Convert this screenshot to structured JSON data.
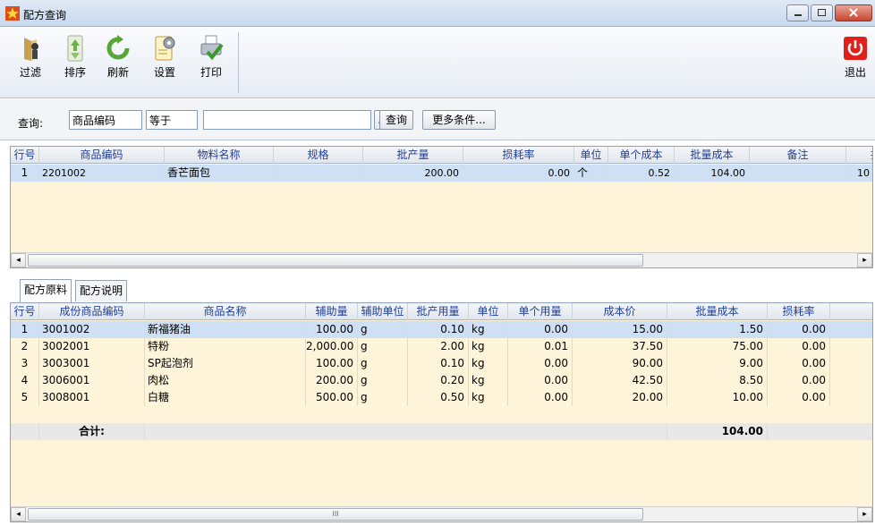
{
  "window": {
    "title": "配方查询"
  },
  "toolbar": {
    "filter": "过滤",
    "sort": "排序",
    "refresh": "刷新",
    "settings": "设置",
    "print": "打印",
    "exit": "退出"
  },
  "query": {
    "label": "查询:",
    "field": "商品编码",
    "operator": "等于",
    "value": "",
    "browse": "...",
    "search": "查询",
    "more": "更多条件..."
  },
  "main_grid": {
    "headers": [
      "行号",
      "商品编码",
      "物料名称",
      "规格",
      "批产量",
      "损耗率",
      "单位",
      "单个成本",
      "批量成本",
      "备注",
      "批"
    ],
    "rows": [
      {
        "no": "1",
        "code": "2201002",
        "name": "香芒面包",
        "spec": "",
        "batch": "200.00",
        "loss": "0.00",
        "unit": "个",
        "unit_cost": "0.52",
        "batch_cost": "104.00",
        "note": "",
        "extra": "10"
      }
    ]
  },
  "tabs": {
    "ingredients": "配方原料",
    "description": "配方说明"
  },
  "detail_grid": {
    "headers": [
      "行号",
      "成份商品编码",
      "商品名称",
      "辅助量",
      "辅助单位",
      "批产用量",
      "单位",
      "单个用量",
      "成本价",
      "批量成本",
      "损耗率"
    ],
    "rows": [
      {
        "no": "1",
        "code": "3001002",
        "name": "新福猪油",
        "aux": "100.00",
        "aux_unit": "g",
        "batch_qty": "0.10",
        "unit": "kg",
        "single": "0.00",
        "price": "15.00",
        "batch_cost": "1.50",
        "loss": "0.00"
      },
      {
        "no": "2",
        "code": "3002001",
        "name": "特粉",
        "aux": "2,000.00",
        "aux_unit": "g",
        "batch_qty": "2.00",
        "unit": "kg",
        "single": "0.01",
        "price": "37.50",
        "batch_cost": "75.00",
        "loss": "0.00"
      },
      {
        "no": "3",
        "code": "3003001",
        "name": "SP起泡剂",
        "aux": "100.00",
        "aux_unit": "g",
        "batch_qty": "0.10",
        "unit": "kg",
        "single": "0.00",
        "price": "90.00",
        "batch_cost": "9.00",
        "loss": "0.00"
      },
      {
        "no": "4",
        "code": "3006001",
        "name": "肉松",
        "aux": "200.00",
        "aux_unit": "g",
        "batch_qty": "0.20",
        "unit": "kg",
        "single": "0.00",
        "price": "42.50",
        "batch_cost": "8.50",
        "loss": "0.00"
      },
      {
        "no": "5",
        "code": "3008001",
        "name": "白糖",
        "aux": "500.00",
        "aux_unit": "g",
        "batch_qty": "0.50",
        "unit": "kg",
        "single": "0.00",
        "price": "20.00",
        "batch_cost": "10.00",
        "loss": "0.00"
      }
    ],
    "total_label": "合计:",
    "total_batch_cost": "104.00"
  },
  "scroll": {
    "left": "◂",
    "right": "▸",
    "grip": "III"
  },
  "colors": {
    "grid_bg": "#fdf4d9",
    "selected": "#cfe0f4",
    "header_text": "#1f3f9b",
    "exit_red": "#e0211b"
  }
}
